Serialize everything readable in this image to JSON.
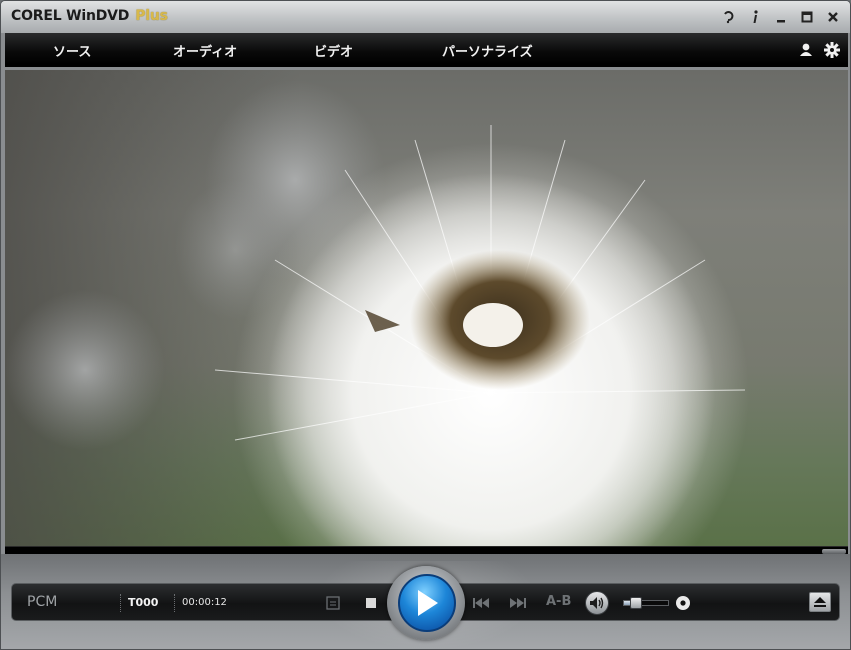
{
  "window": {
    "title_main": "COREL WinDVD",
    "title_plus": "Plus",
    "buttons": [
      {
        "name": "help-icon"
      },
      {
        "name": "info-icon"
      },
      {
        "name": "minimize-icon"
      },
      {
        "name": "maximize-icon"
      },
      {
        "name": "close-icon"
      }
    ]
  },
  "menu": {
    "items": [
      "ソース",
      "オーディオ",
      "ビデオ",
      "パーソナライズ"
    ],
    "right_icons": [
      "user-icon",
      "settings-gear-icon"
    ]
  },
  "video": {
    "content": "dandelion seed head photo"
  },
  "controls": {
    "audio_format": "PCM",
    "title_number": "T000",
    "elapsed_time": "00:00:12",
    "ab_label": "A-B",
    "volume_level": 0.25,
    "accent_color": "#1d86d8"
  }
}
